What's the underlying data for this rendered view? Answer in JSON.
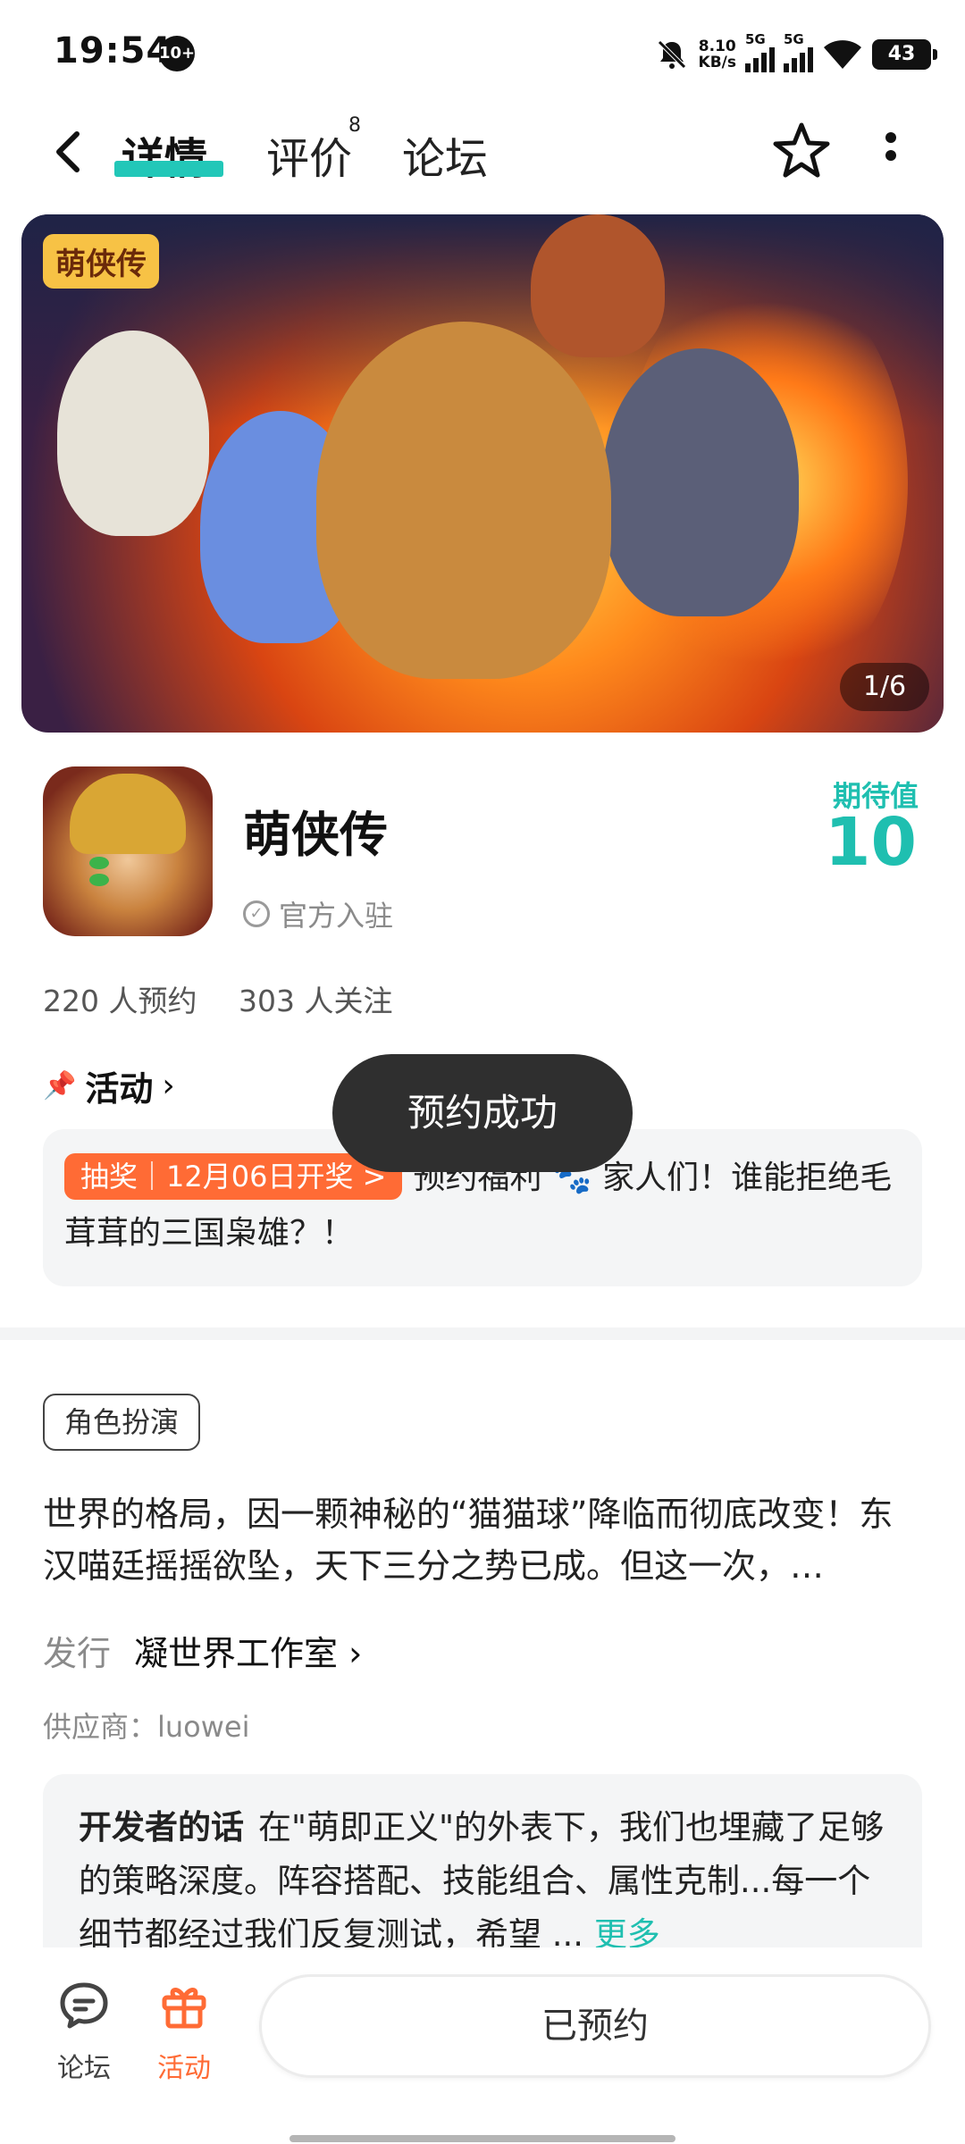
{
  "status_bar": {
    "time": "19:54",
    "notif_count": "10+",
    "net_speed_value": "8.10",
    "net_speed_unit": "KB/s",
    "sim1": "5G",
    "sim2": "5G",
    "battery": "43"
  },
  "header": {
    "tabs": [
      {
        "label": "详情"
      },
      {
        "label": "评价"
      },
      {
        "label": "论坛"
      }
    ],
    "review_count": "8",
    "accent_color": "#22c7b8"
  },
  "banner": {
    "logo_text": "萌侠传",
    "index": "1/6"
  },
  "game": {
    "name": "萌侠传",
    "official_label": "官方入驻",
    "expect_label": "期待值",
    "expect_value": "10",
    "reservations": "220 人预约",
    "followers": "303 人关注"
  },
  "activity": {
    "title": "活动",
    "tag": "抽奖｜12月06日开奖 >",
    "text": "预约福利 🐾 家人们！谁能拒绝毛茸茸的三国枭雄？！"
  },
  "toast": "预约成功",
  "detail": {
    "genre": "角色扮演",
    "description": "世界的格局，因一颗神秘的“猫猫球”降临而彻底改变！东汉喵廷摇摇欲坠，天下三分之势已成。但这一次，…",
    "publisher_key": "发行",
    "publisher_value": "凝世界工作室",
    "supplier": "供应商：luowei",
    "dev_title": "开发者的话",
    "dev_text": "在\"萌即正义\"的外表下，我们也埋藏了足够的策略深度。阵容搭配、技能组合、属性克制...每一个细节都经过我们反复测试，希望 ...",
    "more": "更多"
  },
  "bottom_bar": {
    "forum_label": "论坛",
    "activity_label": "活动",
    "reserved_label": "已预约",
    "activity_color": "#ff6b35"
  }
}
